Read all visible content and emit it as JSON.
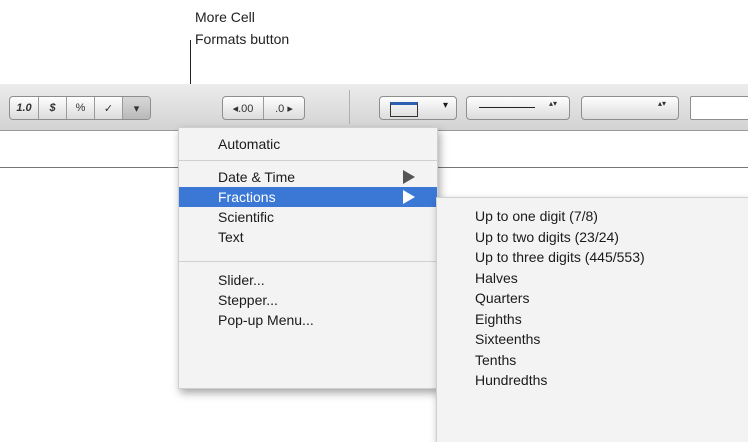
{
  "callout": {
    "line1": "More Cell",
    "line2": "Formats button"
  },
  "toolbar": {
    "number_format": [
      "1.0",
      "$",
      "%",
      "✓",
      "▾"
    ],
    "decimal_decrease": "◂.00",
    "decimal_increase": ".0 ▸",
    "fill_popup_arrow": "▾",
    "line_stepper": "▴▾",
    "size_stepper": "▴▾"
  },
  "menu": {
    "items": [
      {
        "label": "Automatic"
      },
      {
        "label": "Date & Time"
      },
      {
        "label": "Fractions"
      },
      {
        "label": "Scientific"
      },
      {
        "label": "Text"
      },
      {
        "label": "Slider..."
      },
      {
        "label": "Stepper..."
      },
      {
        "label": "Pop-up Menu..."
      }
    ]
  },
  "submenu": {
    "items": [
      {
        "label": "Up to one digit (7/8)"
      },
      {
        "label": "Up to two digits (23/24)"
      },
      {
        "label": "Up to three digits (445/553)"
      },
      {
        "label": "Halves"
      },
      {
        "label": "Quarters"
      },
      {
        "label": "Eighths"
      },
      {
        "label": "Sixteenths"
      },
      {
        "label": "Tenths"
      },
      {
        "label": "Hundredths"
      }
    ]
  },
  "colors": {
    "highlight": "#3b78d6",
    "menu_bg": "#f3f3f3"
  },
  "icons": [
    "chevron-down-icon",
    "submenu-arrow-icon",
    "fill-popup-icon"
  ]
}
